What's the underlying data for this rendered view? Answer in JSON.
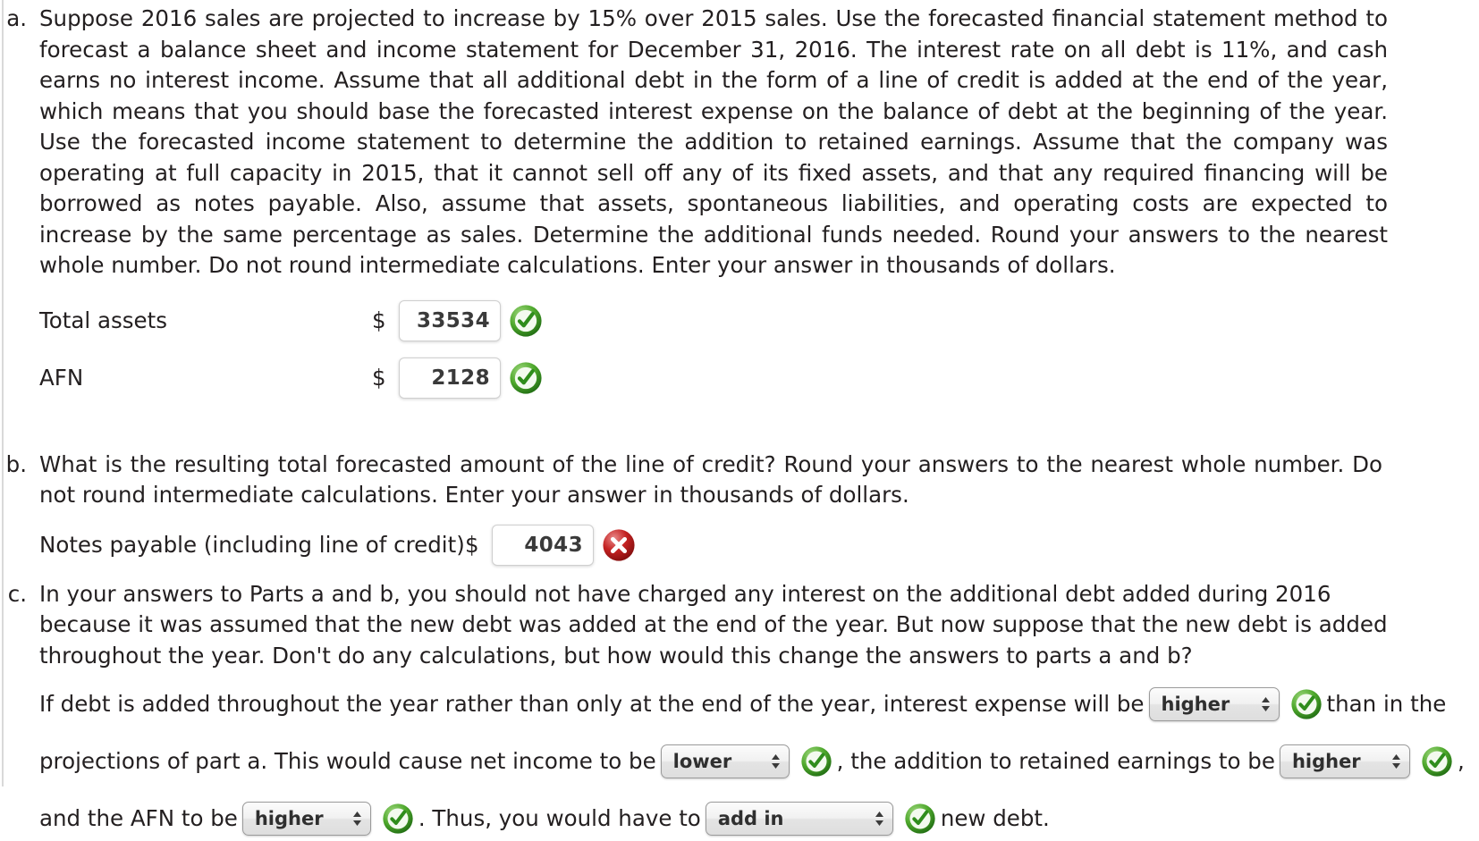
{
  "parts": {
    "a": {
      "label": "a.",
      "text": "Suppose 2016 sales are projected to increase by 15% over 2015 sales. Use the forecasted financial statement method to forecast a balance sheet and income statement for December 31, 2016. The interest rate on all debt is 11%, and cash earns no interest income. Assume that all additional debt in the form of a line of credit is added at the end of the year, which means that you should base the forecasted interest expense on the balance of debt at the beginning of the year. Use the forecasted income statement to determine the addition to retained earnings. Assume that the company was operating at full capacity in 2015, that it cannot sell off any of its fixed assets, and that any required financing will be borrowed as notes payable. Also, assume that assets, spontaneous liabilities, and operating costs are expected to increase by the same percentage as sales. Determine the additional funds needed. Round your answers to the nearest whole number. Do not round intermediate calculations. Enter your answer in thousands of dollars.",
      "rows": [
        {
          "label": "Total assets",
          "currency": "$",
          "value": "33534",
          "status": "correct",
          "status_icon": "green-check-icon"
        },
        {
          "label": "AFN",
          "currency": "$",
          "value": "2128",
          "status": "correct",
          "status_icon": "green-check-icon"
        }
      ]
    },
    "b": {
      "label": "b.",
      "text": "What is the resulting total forecasted amount of the line of credit? Round your answers to the nearest whole number. Do not round intermediate calculations. Enter your answer in thousands of dollars.",
      "rows": [
        {
          "label": "Notes payable (including line of credit)",
          "currency": "$",
          "value": "4043",
          "status": "incorrect",
          "status_icon": "red-x-icon"
        }
      ]
    },
    "c": {
      "label": "c.",
      "text": "In your answers to Parts a and b, you should not have charged any interest on the additional debt added during 2016 because it was assumed that the new debt was added at the end of the year. But now suppose that the new debt is added throughout the year. Don't do any calculations, but how would this change the answers to parts a and b?",
      "sentence": {
        "seg1": "If debt is added throughout the year rather than only at the end of the year, interest expense will be",
        "dropdown1": {
          "value": "higher",
          "status_icon": "green-check-icon"
        },
        "seg2": "than in the",
        "seg3": "projections of part a. This would cause net income to be",
        "dropdown2": {
          "value": "lower",
          "status_icon": "green-check-icon"
        },
        "seg4": ", the addition to retained earnings to be",
        "dropdown3": {
          "value": "higher",
          "status_icon": "green-check-icon"
        },
        "seg5": ",",
        "seg6": "and the AFN to be",
        "dropdown4": {
          "value": "higher",
          "status_icon": "green-check-icon"
        },
        "seg7": ". Thus, you would have to",
        "dropdown5": {
          "value": "add in",
          "status_icon": "green-check-icon"
        },
        "seg8": "new debt."
      }
    }
  },
  "colors": {
    "correct_green": "#3f9a28",
    "incorrect_red": "#c11a1a",
    "text": "#231f20"
  }
}
